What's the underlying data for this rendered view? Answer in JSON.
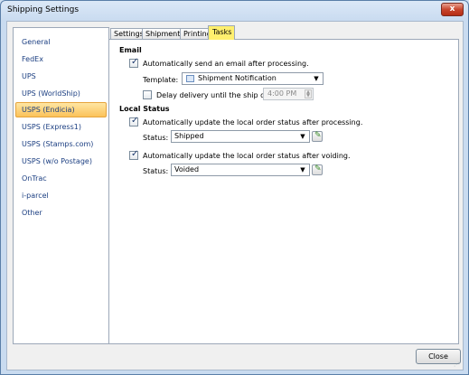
{
  "window": {
    "title": "Shipping Settings",
    "close_glyph": "x"
  },
  "nav": {
    "items": [
      {
        "label": "General"
      },
      {
        "label": "FedEx"
      },
      {
        "label": "UPS"
      },
      {
        "label": "UPS (WorldShip)"
      },
      {
        "label": "USPS (Endicia)",
        "selected": true
      },
      {
        "label": "USPS (Express1)"
      },
      {
        "label": "USPS (Stamps.com)"
      },
      {
        "label": "USPS (w/o Postage)"
      },
      {
        "label": "OnTrac"
      },
      {
        "label": "i-parcel"
      },
      {
        "label": "Other"
      }
    ]
  },
  "tabs": [
    {
      "label": "Settings"
    },
    {
      "label": "Shipments"
    },
    {
      "label": "Printing"
    },
    {
      "label": "Tasks",
      "active": true
    }
  ],
  "email": {
    "header": "Email",
    "auto_send_label": "Automatically send an email after processing.",
    "auto_send_checked": true,
    "template_label": "Template:",
    "template_value": "Shipment Notification",
    "delay_label": "Delay delivery until the ship date at",
    "delay_checked": false,
    "delay_time": "4:00 PM"
  },
  "local_status": {
    "header": "Local Status",
    "processing_label": "Automatically update the local order status after processing.",
    "processing_checked": true,
    "processing_status_label": "Status:",
    "processing_status_value": "Shipped",
    "voiding_label": "Automatically update the local order status after voiding.",
    "voiding_checked": true,
    "voiding_status_label": "Status:",
    "voiding_status_value": "Voided"
  },
  "footer": {
    "close_label": "Close"
  },
  "colors": {
    "selected_nav": "#fbc25a",
    "active_tab": "#ffef6e",
    "title_close": "#c8452d"
  }
}
